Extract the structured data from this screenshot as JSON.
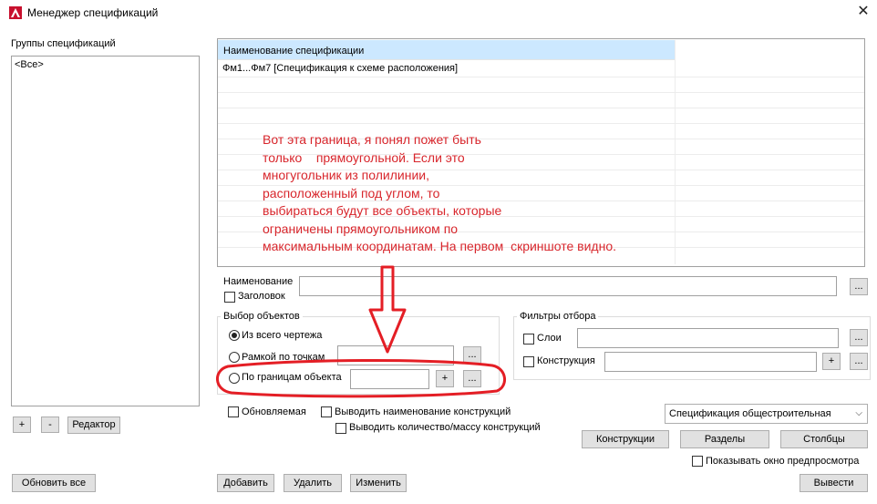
{
  "window": {
    "title": "Менеджер спецификаций",
    "close_glyph": "✕"
  },
  "groups": {
    "label": "Группы спецификаций",
    "items": [
      "<Все>"
    ]
  },
  "spec_table": {
    "column_header": "Наименование спецификации",
    "rows": [
      "Фм1...Фм7 [Спецификация к схеме расположения]"
    ]
  },
  "annotation": {
    "lines": [
      "Вот эта граница, я понял пожет быть",
      "только    прямоугольной. Если это",
      "многугольник из полилинии,",
      "расположенный под углом, то",
      "выбираться будут все объекты, которые",
      "ограничены прямоугольником по",
      "максимальным координатам. На первом  скриншоте видно."
    ],
    "color": "#d8262c"
  },
  "name_section": {
    "label": "Наименование",
    "value": "",
    "browse": "...",
    "header_checkbox": "Заголовок"
  },
  "object_selection": {
    "label": "Выбор объектов",
    "whole_drawing": "Из всего чертежа",
    "by_points": "Рамкой по точкам",
    "by_border": "По границам объекта",
    "browse": "...",
    "plus": "+",
    "selected": "Из всего чертежа"
  },
  "filters": {
    "label": "Фильтры отбора",
    "layers": "Слои",
    "construction": "Конструкция",
    "browse": "...",
    "plus": "+"
  },
  "options": {
    "updatable": "Обновляемая",
    "output_name": "Выводить наименование конструкций",
    "output_qty": "Выводить количество/массу конструкций"
  },
  "spec_type": {
    "selected": "Спецификация общестроительная"
  },
  "section_buttons": {
    "constructions": "Конструкции",
    "sections": "Разделы",
    "columns": "Столбцы"
  },
  "preview": {
    "label": "Показывать окно предпросмотра"
  },
  "left_buttons": {
    "plus": "+",
    "minus": "-",
    "editor": "Редактор",
    "update_all": "Обновить все"
  },
  "bottom_buttons": {
    "add": "Добавить",
    "delete": "Удалить",
    "edit": "Изменить",
    "exit": "Вывести"
  }
}
